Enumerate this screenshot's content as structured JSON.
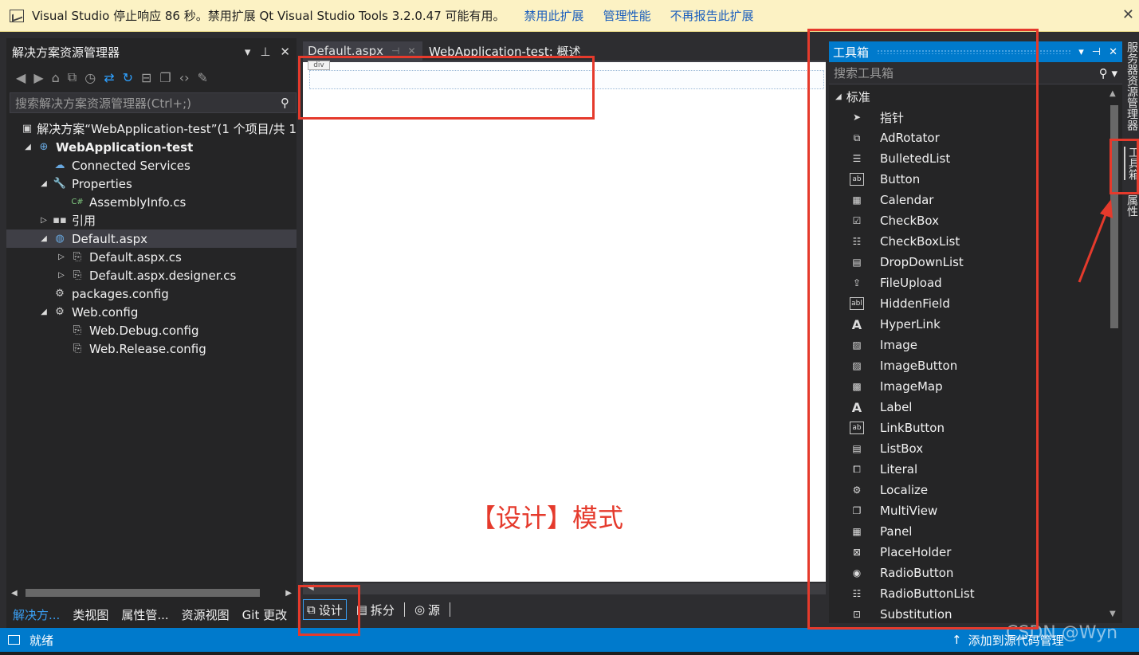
{
  "infobar": {
    "message": "Visual Studio 停止响应 86 秒。禁用扩展 Qt Visual Studio Tools 3.2.0.47 可能有用。",
    "links": [
      "禁用此扩展",
      "管理性能",
      "不再报告此扩展"
    ],
    "close": "✕"
  },
  "solution_explorer": {
    "title": "解决方案资源管理器",
    "title_buttons": [
      "▾",
      "📌",
      "✕"
    ],
    "search_placeholder": "搜索解决方案资源管理器(Ctrl+;)",
    "tree": [
      {
        "label": "解决方案“WebApplication-test”(1 个项目/共 1",
        "icon": "solution-icon",
        "arrow": ""
      },
      {
        "label": "WebApplication-test",
        "icon": "web-project-icon",
        "arrow": "◢",
        "bold": true
      },
      {
        "label": "Connected Services",
        "icon": "connected-services-icon",
        "arrow": ""
      },
      {
        "label": "Properties",
        "icon": "wrench-icon",
        "arrow": "◢"
      },
      {
        "label": "AssemblyInfo.cs",
        "icon": "csharp-file-icon",
        "arrow": ""
      },
      {
        "label": "引用",
        "icon": "references-icon",
        "arrow": "▷"
      },
      {
        "label": "Default.aspx",
        "icon": "aspx-file-icon",
        "arrow": "◢",
        "selected": true
      },
      {
        "label": "Default.aspx.cs",
        "icon": "cs-code-file-icon",
        "arrow": "▷"
      },
      {
        "label": "Default.aspx.designer.cs",
        "icon": "cs-code-file-icon",
        "arrow": "▷"
      },
      {
        "label": "packages.config",
        "icon": "config-file-icon",
        "arrow": ""
      },
      {
        "label": "Web.config",
        "icon": "config-file-icon",
        "arrow": "◢"
      },
      {
        "label": "Web.Debug.config",
        "icon": "config-transform-icon",
        "arrow": ""
      },
      {
        "label": "Web.Release.config",
        "icon": "config-transform-icon",
        "arrow": ""
      }
    ],
    "bottom_tabs": [
      "解决方...",
      "类视图",
      "属性管...",
      "资源视图",
      "Git 更改"
    ]
  },
  "editor": {
    "tabs": [
      "Default.aspx",
      "WebApplication-test: 概述"
    ],
    "div_tag": "div",
    "view_tabs": [
      "设计",
      "拆分",
      "源"
    ],
    "annotation": "【设计】模式"
  },
  "toolbox": {
    "title": "工具箱",
    "search_placeholder": "搜索工具箱",
    "category": "标准",
    "items": [
      {
        "label": "指针",
        "icon": "pointer-icon"
      },
      {
        "label": "AdRotator",
        "icon": "adrotator-icon"
      },
      {
        "label": "BulletedList",
        "icon": "bulleted-list-icon"
      },
      {
        "label": "Button",
        "icon": "button-icon"
      },
      {
        "label": "Calendar",
        "icon": "calendar-icon"
      },
      {
        "label": "CheckBox",
        "icon": "checkbox-icon"
      },
      {
        "label": "CheckBoxList",
        "icon": "checkbox-list-icon"
      },
      {
        "label": "DropDownList",
        "icon": "dropdown-list-icon"
      },
      {
        "label": "FileUpload",
        "icon": "file-upload-icon"
      },
      {
        "label": "HiddenField",
        "icon": "hidden-field-icon"
      },
      {
        "label": "HyperLink",
        "icon": "hyperlink-icon"
      },
      {
        "label": "Image",
        "icon": "image-icon"
      },
      {
        "label": "ImageButton",
        "icon": "image-button-icon"
      },
      {
        "label": "ImageMap",
        "icon": "image-map-icon"
      },
      {
        "label": "Label",
        "icon": "label-icon"
      },
      {
        "label": "LinkButton",
        "icon": "link-button-icon"
      },
      {
        "label": "ListBox",
        "icon": "list-box-icon"
      },
      {
        "label": "Literal",
        "icon": "literal-icon"
      },
      {
        "label": "Localize",
        "icon": "localize-icon"
      },
      {
        "label": "MultiView",
        "icon": "multiview-icon"
      },
      {
        "label": "Panel",
        "icon": "panel-icon"
      },
      {
        "label": "PlaceHolder",
        "icon": "placeholder-icon"
      },
      {
        "label": "RadioButton",
        "icon": "radio-button-icon"
      },
      {
        "label": "RadioButtonList",
        "icon": "radio-button-list-icon"
      },
      {
        "label": "Substitution",
        "icon": "substitution-icon"
      }
    ]
  },
  "side_tabs": [
    "服务器资源管理器",
    "工具箱",
    "属性"
  ],
  "statusbar": {
    "status": "就绪",
    "right": "添加到源代码管理"
  },
  "watermark": "CSDN @Wyn",
  "colors": {
    "accent": "#007acc",
    "annotation_red": "#e53a2c",
    "infobar_bg": "#fcf2c4",
    "panel_bg": "#252526"
  }
}
